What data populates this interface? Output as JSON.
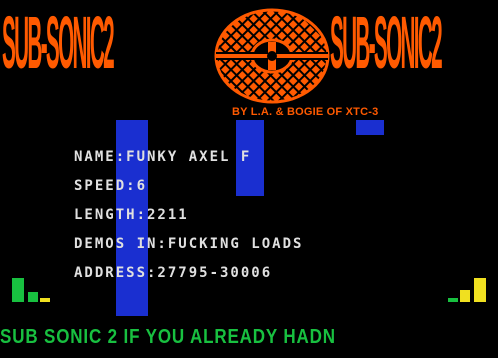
{
  "logo": {
    "left_text": "SUB-SONIC2",
    "right_text": "SUB-SONIC2",
    "credit": "BY L.A. & BOGIE OF XTC-3"
  },
  "info": {
    "name": "NAME:FUNKY AXEL F",
    "speed": "SPEED:6",
    "length": "LENGTH:2211",
    "demos": "DEMOS IN:FUCKING LOADS",
    "address": "ADDRESS:27795-30006"
  },
  "scroller": {
    "text": "SUB SONIC 2 IF YOU ALREADY HADN"
  },
  "colors": {
    "logo": "#ff5a00",
    "raster_bar": "#1a2fd0",
    "info_text": "#e0e0e0",
    "vu_left": "#18c040",
    "vu_right": "#f0e020",
    "scroller": "#18c040",
    "background": "#000000"
  }
}
